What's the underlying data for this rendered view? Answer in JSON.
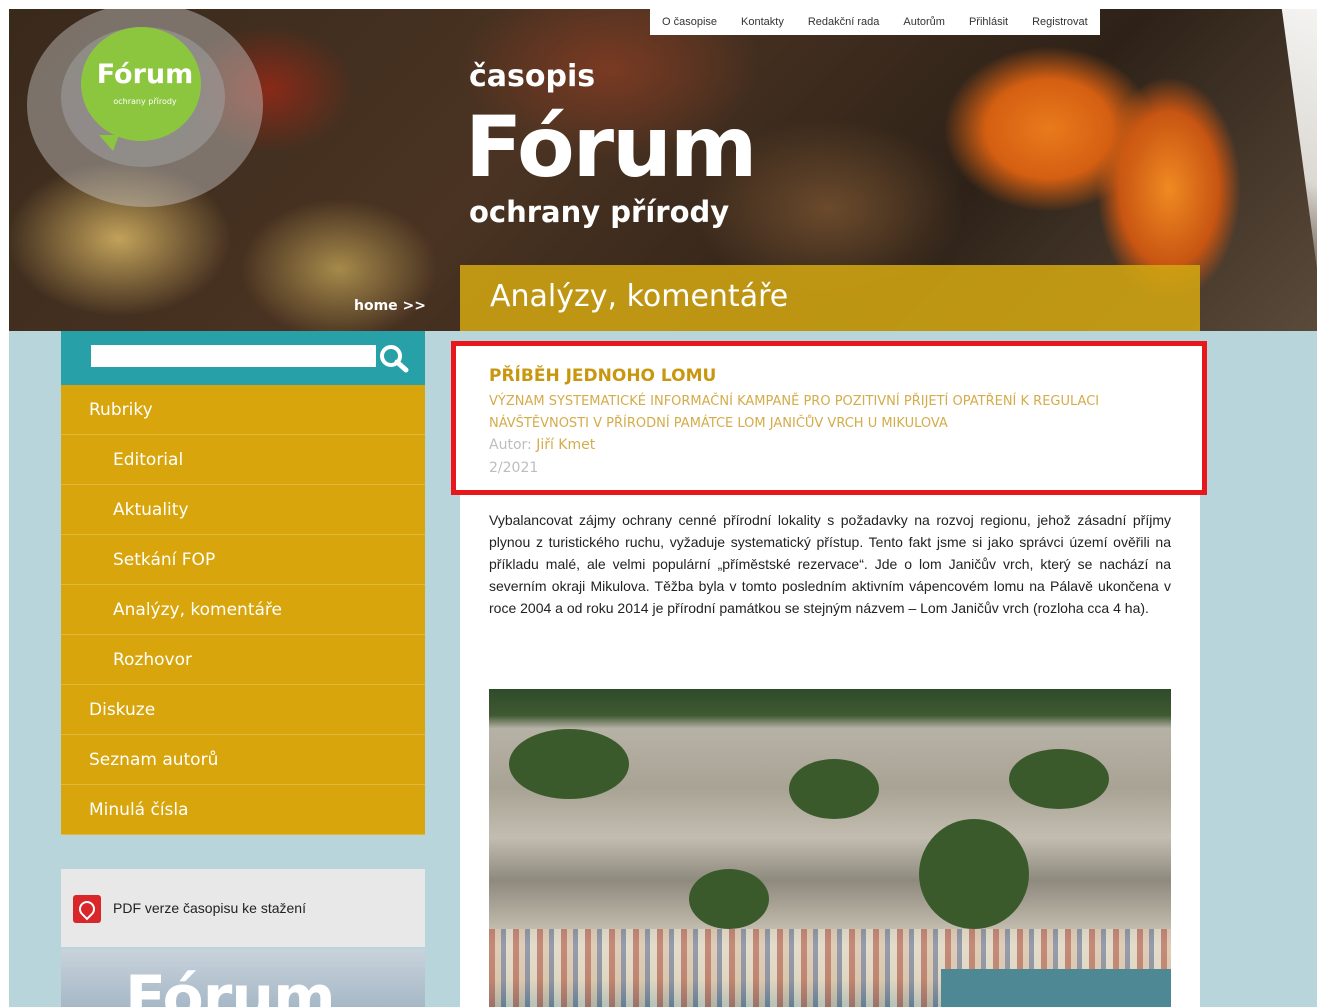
{
  "top_nav": [
    "O časopise",
    "Kontakty",
    "Redakční rada",
    "Autorům",
    "Přihlásit",
    "Registrovat"
  ],
  "logo": {
    "title": "Fórum",
    "subtitle": "ochrany přírody"
  },
  "masthead": {
    "small": "časopis",
    "big": "Fórum",
    "sub": "ochrany přírody"
  },
  "home_link": "home >>",
  "section_title": "Analýzy, komentáře",
  "search": {
    "placeholder": ""
  },
  "menu": [
    {
      "label": "Rubriky",
      "level": "top"
    },
    {
      "label": "Editorial",
      "level": "sub"
    },
    {
      "label": "Aktuality",
      "level": "sub"
    },
    {
      "label": "Setkání FOP",
      "level": "sub"
    },
    {
      "label": "Analýzy, komentáře",
      "level": "sub"
    },
    {
      "label": "Rozhovor",
      "level": "sub"
    },
    {
      "label": "Diskuze",
      "level": "top"
    },
    {
      "label": "Seznam autorů",
      "level": "top"
    },
    {
      "label": "Minulá čísla",
      "level": "top"
    }
  ],
  "pdf": {
    "label": "PDF verze časopisu ke stažení"
  },
  "cover_title": "Fórum",
  "article": {
    "title": "PŘÍBĚH JEDNOHO LOMU",
    "subtitle": "Význam systematické informační kampaně pro pozitivní přijetí opatření k regulaci návštěvnosti v přírodní památce Lom Janičův vrch u Mikulova",
    "author_label": "Autor:",
    "author_name": "Jiří Kmet",
    "issue": "2/2021",
    "body": "Vybalancovat zájmy ochrany cenné přírodní lokality s požadavky na rozvoj regionu, jehož zásadní příjmy plynou z turistického ruchu, vyžaduje systematický přístup. Tento fakt jsme si jako správci území ověřili na příkladu malé, ale velmi populární „příměstské rezervace“. Jde o lom Janičův vrch, který se nachází na severním okraji Mikulova. Těžba byla v tomto posledním aktivním vápencovém lomu na Pálavě ukončena v roce 2004 a od roku 2014 je přírodní památkou se stejným názvem – Lom Janičův vrch (rozloha cca 4 ha)."
  },
  "colors": {
    "accent": "#d8a50c",
    "teal": "#27a0a8",
    "highlight": "#e8171b",
    "background": "#b9d5dc"
  }
}
